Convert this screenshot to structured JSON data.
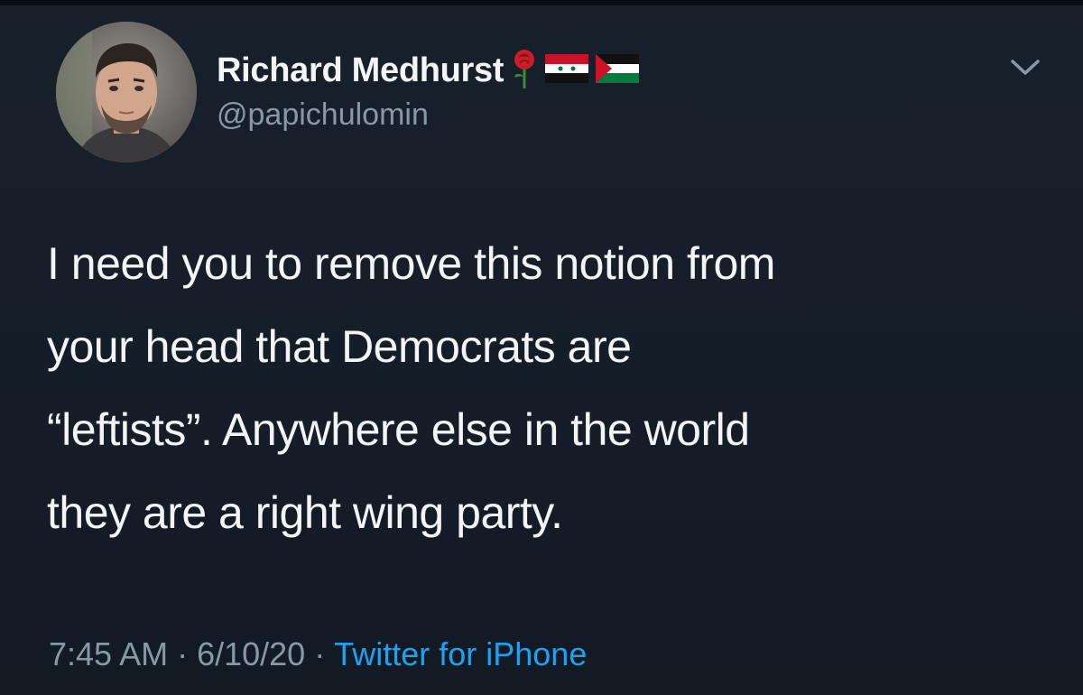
{
  "tweet": {
    "author": {
      "display_name": "Richard Medhurst",
      "handle": "@papichulomin",
      "name_emojis": [
        "rose-emoji",
        "syria-flag-emoji",
        "palestine-flag-emoji"
      ]
    },
    "text_lines": [
      "I need you to remove this notion from",
      "your head that Democrats are",
      "“leftists”. Anywhere else in the world",
      "they are a right wing party."
    ],
    "time": "7:45 AM",
    "date": "6/10/20",
    "separator": "·",
    "source": "Twitter for iPhone",
    "menu_icon": "chevron-down-icon"
  },
  "colors": {
    "background": "#15202b",
    "primary_text": "#f2f4f6",
    "secondary_text": "#8899a6",
    "link": "#1da1f2"
  }
}
